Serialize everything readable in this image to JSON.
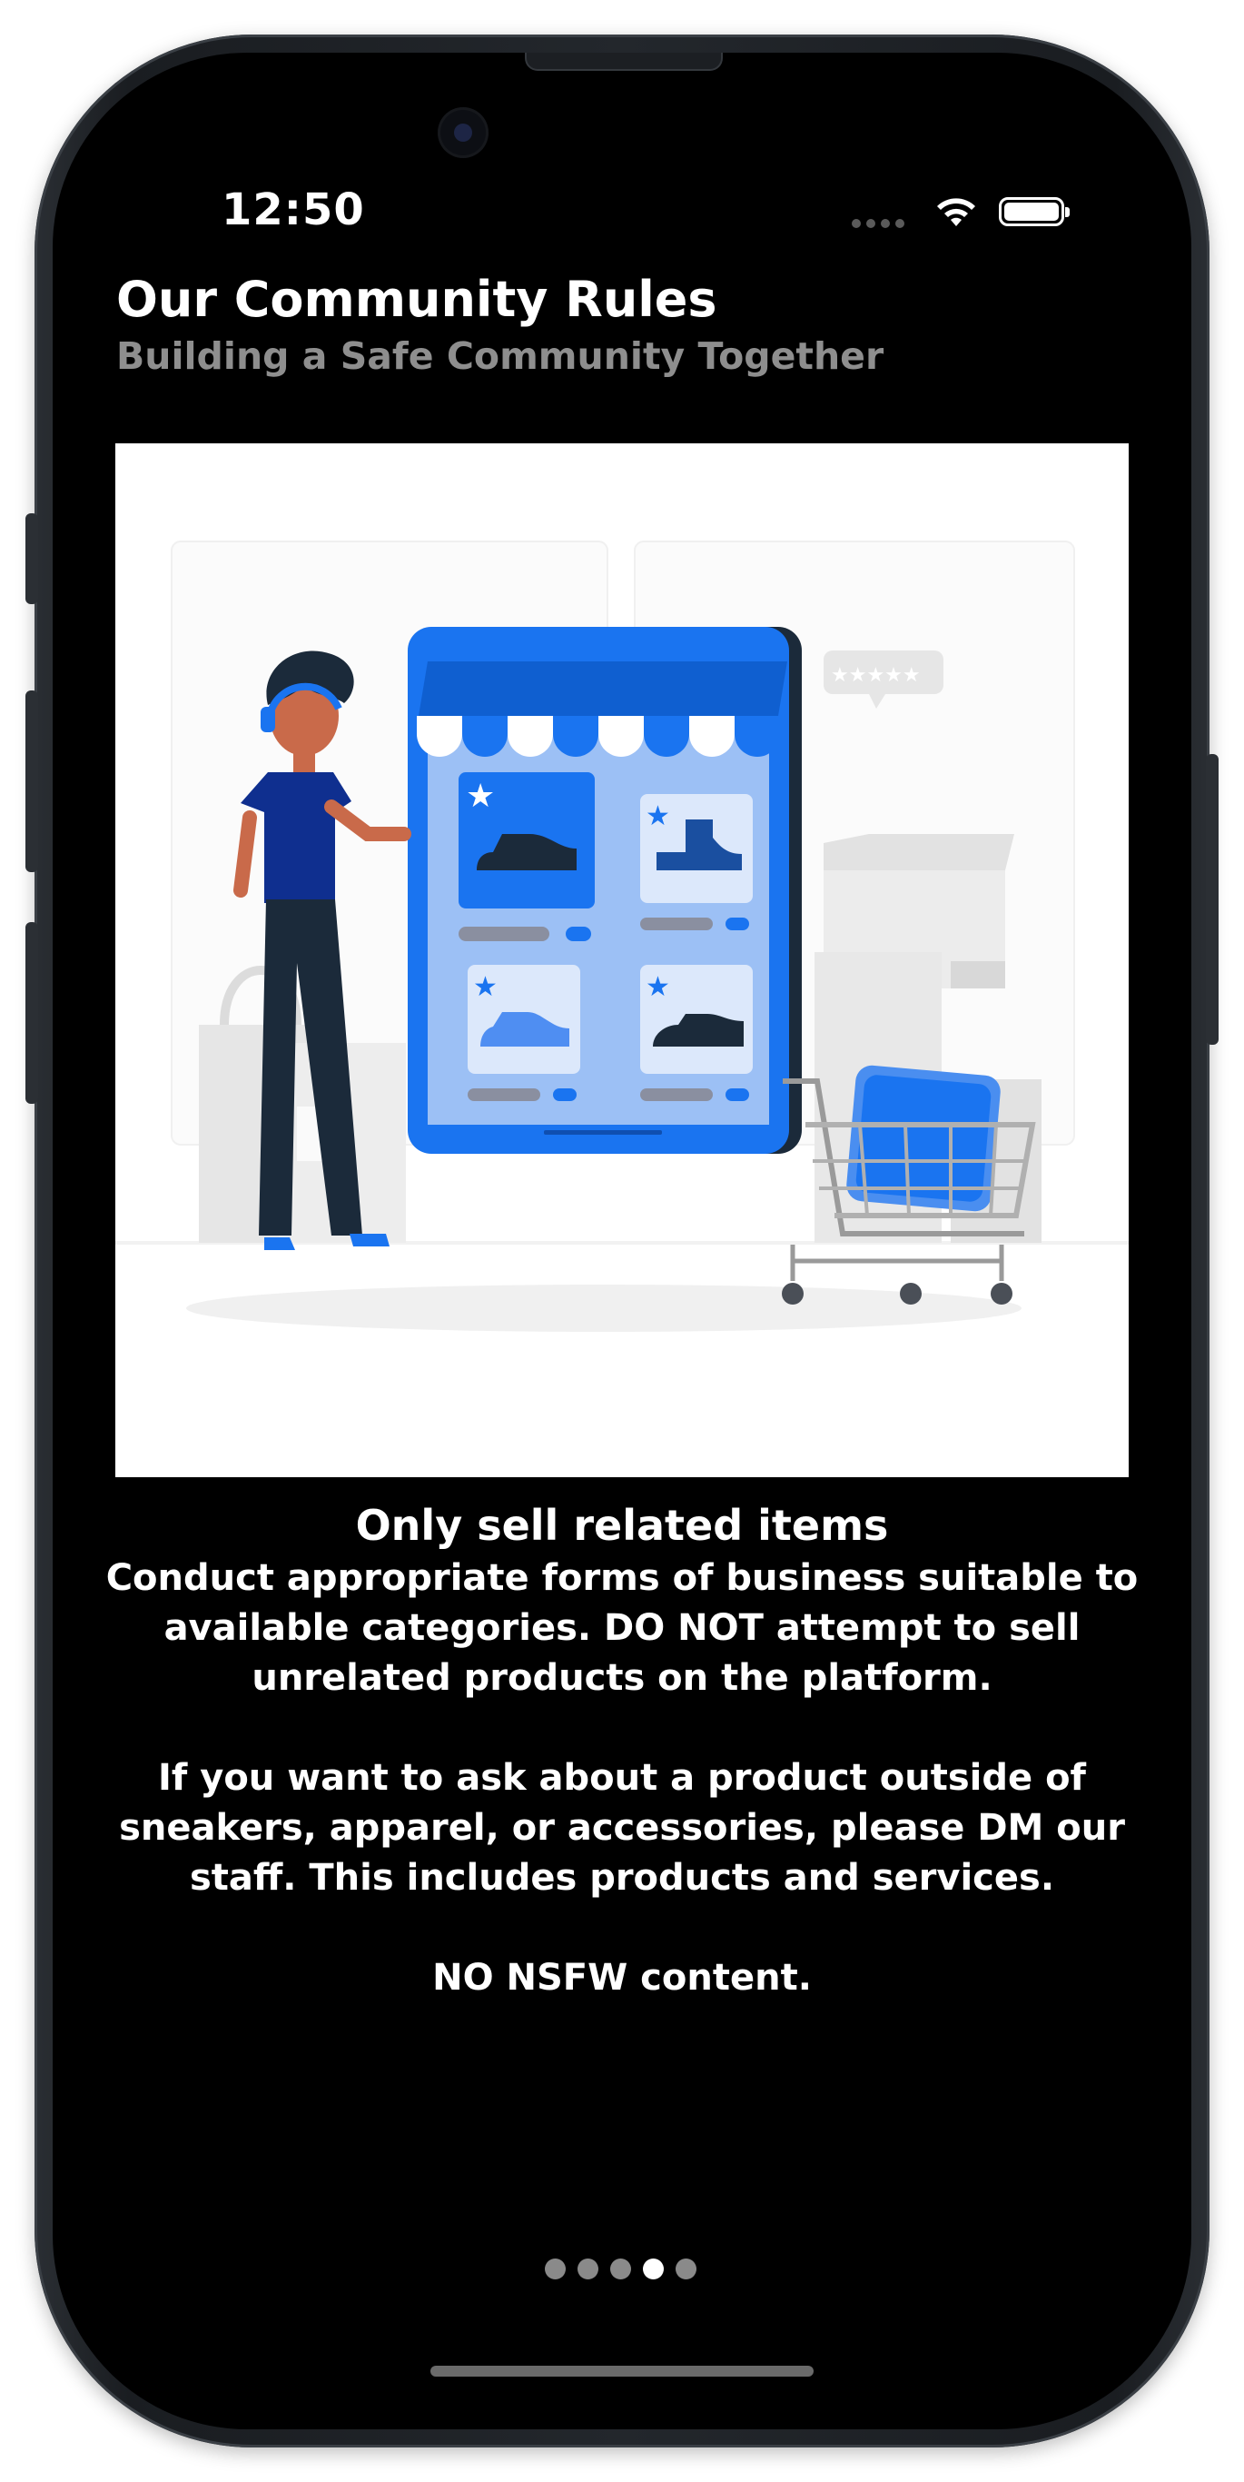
{
  "status_bar": {
    "time": "12:50"
  },
  "header": {
    "title": "Our Community Rules",
    "subtitle": "Building a Safe Community Together"
  },
  "rule": {
    "title": "Only sell related items",
    "paragraphs": [
      "Conduct appropriate forms of business suitable to available categories. DO NOT attempt to sell unrelated products on the platform.",
      "If you want to ask about a product outside of sneakers, apparel, or accessories, please DM our staff. This includes products and services.",
      "NO NSFW content."
    ]
  },
  "pager": {
    "total": 5,
    "active_index": 3
  },
  "colors": {
    "background": "#000000",
    "title": "#ffffff",
    "subtitle": "#8e8e8e",
    "accent": "#1a74f0",
    "dot_inactive": "#8a8a8a",
    "dot_active": "#ffffff"
  }
}
